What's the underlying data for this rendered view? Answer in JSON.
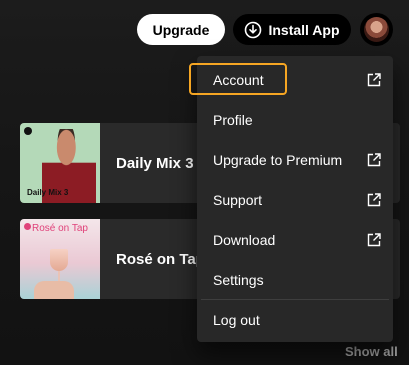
{
  "header": {
    "upgrade_label": "Upgrade",
    "install_label": "Install App"
  },
  "cards": [
    {
      "title": "Daily Mix 3",
      "cover_label": "Daily Mix 3"
    },
    {
      "title": "Rosé on Tap",
      "cover_label": "Rosé on Tap"
    }
  ],
  "show_all_label": "Show all",
  "menu": {
    "items": [
      {
        "label": "Account",
        "external": true,
        "focused": true
      },
      {
        "label": "Profile",
        "external": false
      },
      {
        "label": "Upgrade to Premium",
        "external": true
      },
      {
        "label": "Support",
        "external": true
      },
      {
        "label": "Download",
        "external": true
      },
      {
        "label": "Settings",
        "external": false
      },
      {
        "label": "Log out",
        "external": false
      }
    ]
  },
  "colors": {
    "background": "#121212",
    "menu_bg": "#282828",
    "card_bg": "#2a2a2a",
    "focus_ring": "#f6a623",
    "muted_text": "#a7a7a7"
  },
  "icons": {
    "install": "download-circle-icon",
    "external": "external-link-icon",
    "avatar": "user-avatar"
  }
}
